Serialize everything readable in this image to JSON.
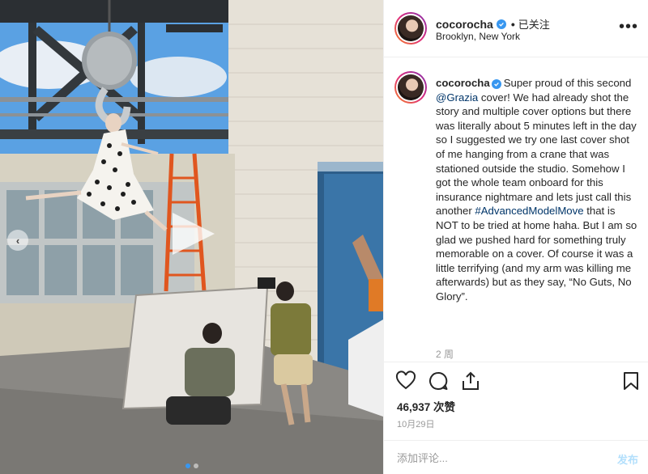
{
  "post": {
    "username": "cocorocha",
    "follow_sep": "•",
    "follow_label": "已关注",
    "location": "Brooklyn, New York",
    "more_label": "•••",
    "caption": {
      "username": "cocorocha",
      "part1": "Super proud of this second ",
      "mention": "@Grazia",
      "part2": " cover! We had already shot the story and multiple cover options but there was literally about 5 minutes left in the day so I suggested we try one last cover shot of me hanging from a crane that was stationed outside the studio. Somehow I got the whole team onboard for this insurance nightmare and lets just call this another ",
      "hashtag": "#AdvancedModelMove",
      "part3": " that is NOT to be tried at home haha. But I am so glad we pushed hard for something truly memorable on a cover. Of course it was a little terrifying (and my arm was killing me afterwards) but as they say, “No Guts, No Glory”."
    },
    "time_ago": "2 周",
    "likes": "46,937 次赞",
    "date": "10月29日",
    "comment_placeholder": "添加评论...",
    "post_button": "发布",
    "carousel_prev": "‹",
    "icons": [
      "verified-badge",
      "heart-icon",
      "comment-icon",
      "share-icon",
      "bookmark-icon",
      "play-icon",
      "chevron-left-icon"
    ],
    "colors": {
      "verified": "#3897f0",
      "link": "#003569",
      "muted": "#999999",
      "post_disabled": "#b2dffc",
      "active_dot": "#3897f0"
    }
  }
}
